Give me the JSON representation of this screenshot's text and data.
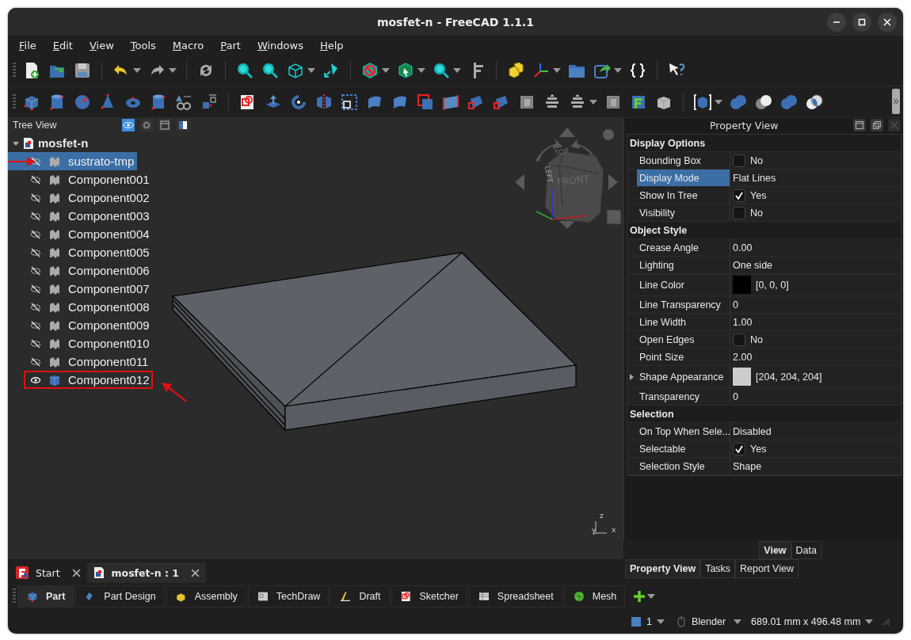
{
  "window": {
    "title": "mosfet-n - FreeCAD 1.1.1"
  },
  "menu": [
    "File",
    "Edit",
    "View",
    "Tools",
    "Macro",
    "Part",
    "Windows",
    "Help"
  ],
  "tree_view": {
    "title": "Tree View",
    "document": {
      "name": "mosfet-n",
      "expanded": true
    },
    "items": [
      {
        "name": "sustrato-tmp",
        "visible": false,
        "selected": true,
        "arrow": true,
        "boxed": false
      },
      {
        "name": "Component001",
        "visible": false,
        "selected": false,
        "arrow": false,
        "boxed": false
      },
      {
        "name": "Component002",
        "visible": false,
        "selected": false,
        "arrow": false,
        "boxed": false
      },
      {
        "name": "Component003",
        "visible": false,
        "selected": false,
        "arrow": false,
        "boxed": false
      },
      {
        "name": "Component004",
        "visible": false,
        "selected": false,
        "arrow": false,
        "boxed": false
      },
      {
        "name": "Component005",
        "visible": false,
        "selected": false,
        "arrow": false,
        "boxed": false
      },
      {
        "name": "Component006",
        "visible": false,
        "selected": false,
        "arrow": false,
        "boxed": false
      },
      {
        "name": "Component007",
        "visible": false,
        "selected": false,
        "arrow": false,
        "boxed": false
      },
      {
        "name": "Component008",
        "visible": false,
        "selected": false,
        "arrow": false,
        "boxed": false
      },
      {
        "name": "Component009",
        "visible": false,
        "selected": false,
        "arrow": false,
        "boxed": false
      },
      {
        "name": "Component010",
        "visible": false,
        "selected": false,
        "arrow": false,
        "boxed": false
      },
      {
        "name": "Component011",
        "visible": false,
        "selected": false,
        "arrow": false,
        "boxed": false
      },
      {
        "name": "Component012",
        "visible": true,
        "selected": false,
        "arrow": true,
        "boxed": true
      }
    ]
  },
  "view_3d": {
    "nav_cube": {
      "faces": [
        "TOP",
        "FRONT",
        "LEFT"
      ]
    },
    "axes": [
      "z",
      "y",
      "x"
    ]
  },
  "property_view": {
    "title": "Property View",
    "rows": [
      {
        "kind": "group",
        "label": "Display Options"
      },
      {
        "kind": "bool",
        "name": "Bounding Box",
        "checked": false,
        "value": "No",
        "selected": false
      },
      {
        "kind": "text",
        "name": "Display Mode",
        "value": "Flat Lines",
        "selected": true
      },
      {
        "kind": "bool",
        "name": "Show In Tree",
        "checked": true,
        "value": "Yes",
        "selected": false
      },
      {
        "kind": "bool",
        "name": "Visibility",
        "checked": false,
        "value": "No",
        "selected": false
      },
      {
        "kind": "group",
        "label": "Object Style"
      },
      {
        "kind": "text",
        "name": "Crease Angle",
        "value": "0.00",
        "selected": false
      },
      {
        "kind": "text",
        "name": "Lighting",
        "value": "One side",
        "selected": false
      },
      {
        "kind": "color",
        "name": "Line Color",
        "color": "#000000",
        "value": "[0, 0, 0]",
        "selected": false
      },
      {
        "kind": "text",
        "name": "Line Transparency",
        "value": "0",
        "selected": false
      },
      {
        "kind": "text",
        "name": "Line Width",
        "value": "1.00",
        "selected": false
      },
      {
        "kind": "bool",
        "name": "Open Edges",
        "checked": false,
        "value": "No",
        "selected": false
      },
      {
        "kind": "text",
        "name": "Point Size",
        "value": "2.00",
        "selected": false
      },
      {
        "kind": "color",
        "name": "Shape Appearance",
        "color": "#cccccc",
        "value": "[204, 204, 204]",
        "selected": false,
        "expanded": false
      },
      {
        "kind": "text",
        "name": "Transparency",
        "value": "0",
        "selected": false
      },
      {
        "kind": "group",
        "label": "Selection"
      },
      {
        "kind": "text",
        "name": "On Top When Sele...",
        "value": "Disabled",
        "selected": false
      },
      {
        "kind": "bool",
        "name": "Selectable",
        "checked": true,
        "value": "Yes",
        "selected": false
      },
      {
        "kind": "text",
        "name": "Selection Style",
        "value": "Shape",
        "selected": false
      }
    ]
  },
  "panel_tabs": [
    {
      "label": "View",
      "selected": true
    },
    {
      "label": "Data",
      "selected": false
    }
  ],
  "combo_tabs": [
    {
      "label": "Property View",
      "selected": true
    },
    {
      "label": "Tasks",
      "selected": false
    },
    {
      "label": "Report View",
      "selected": false
    }
  ],
  "document_tabs": [
    {
      "label": "Start",
      "kind": "start",
      "selected": false
    },
    {
      "label": "mosfet-n : 1",
      "kind": "document",
      "selected": true
    }
  ],
  "workbenches": [
    {
      "label": "Part",
      "selected": true
    },
    {
      "label": "Part Design",
      "selected": false
    },
    {
      "label": "Assembly",
      "selected": false
    },
    {
      "label": "TechDraw",
      "selected": false
    },
    {
      "label": "Draft",
      "selected": false
    },
    {
      "label": "Sketcher",
      "selected": false
    },
    {
      "label": "Spreadsheet",
      "selected": false
    },
    {
      "label": "Mesh",
      "selected": false
    }
  ],
  "status_bar": {
    "count": "1",
    "navigation": "Blender",
    "dimensions": "689.01 mm x 496.48 mm"
  }
}
